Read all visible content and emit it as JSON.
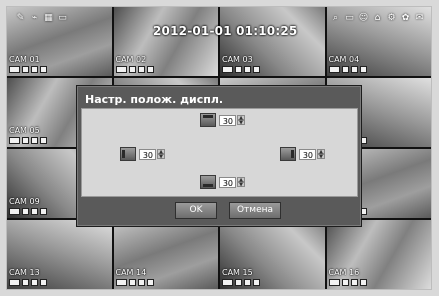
{
  "overlay": {
    "datetime": "2012-01-01 01:10:25",
    "top_left_icons": [
      "wrench-icon",
      "antenna-icon",
      "grid-icon",
      "monitor-icon"
    ],
    "top_right_icons": [
      "search-icon",
      "display-icon",
      "person-icon",
      "lock-icon",
      "gear-icon",
      "settings-icon",
      "mail-icon"
    ]
  },
  "cameras": [
    {
      "label": "CAM 01"
    },
    {
      "label": "CAM 02"
    },
    {
      "label": "CAM 03"
    },
    {
      "label": "CAM 04"
    },
    {
      "label": "CAM 05"
    },
    {
      "label": ""
    },
    {
      "label": ""
    },
    {
      "label": ""
    },
    {
      "label": "CAM 09"
    },
    {
      "label": ""
    },
    {
      "label": ""
    },
    {
      "label": ""
    },
    {
      "label": "CAM 13"
    },
    {
      "label": "CAM 14"
    },
    {
      "label": "CAM 15"
    },
    {
      "label": "CAM 16"
    }
  ],
  "dialog": {
    "title": "Настр. полож. диспл.",
    "top_value": "30",
    "left_value": "30",
    "right_value": "30",
    "bottom_value": "30",
    "ok_label": "OK",
    "cancel_label": "Отмена"
  }
}
